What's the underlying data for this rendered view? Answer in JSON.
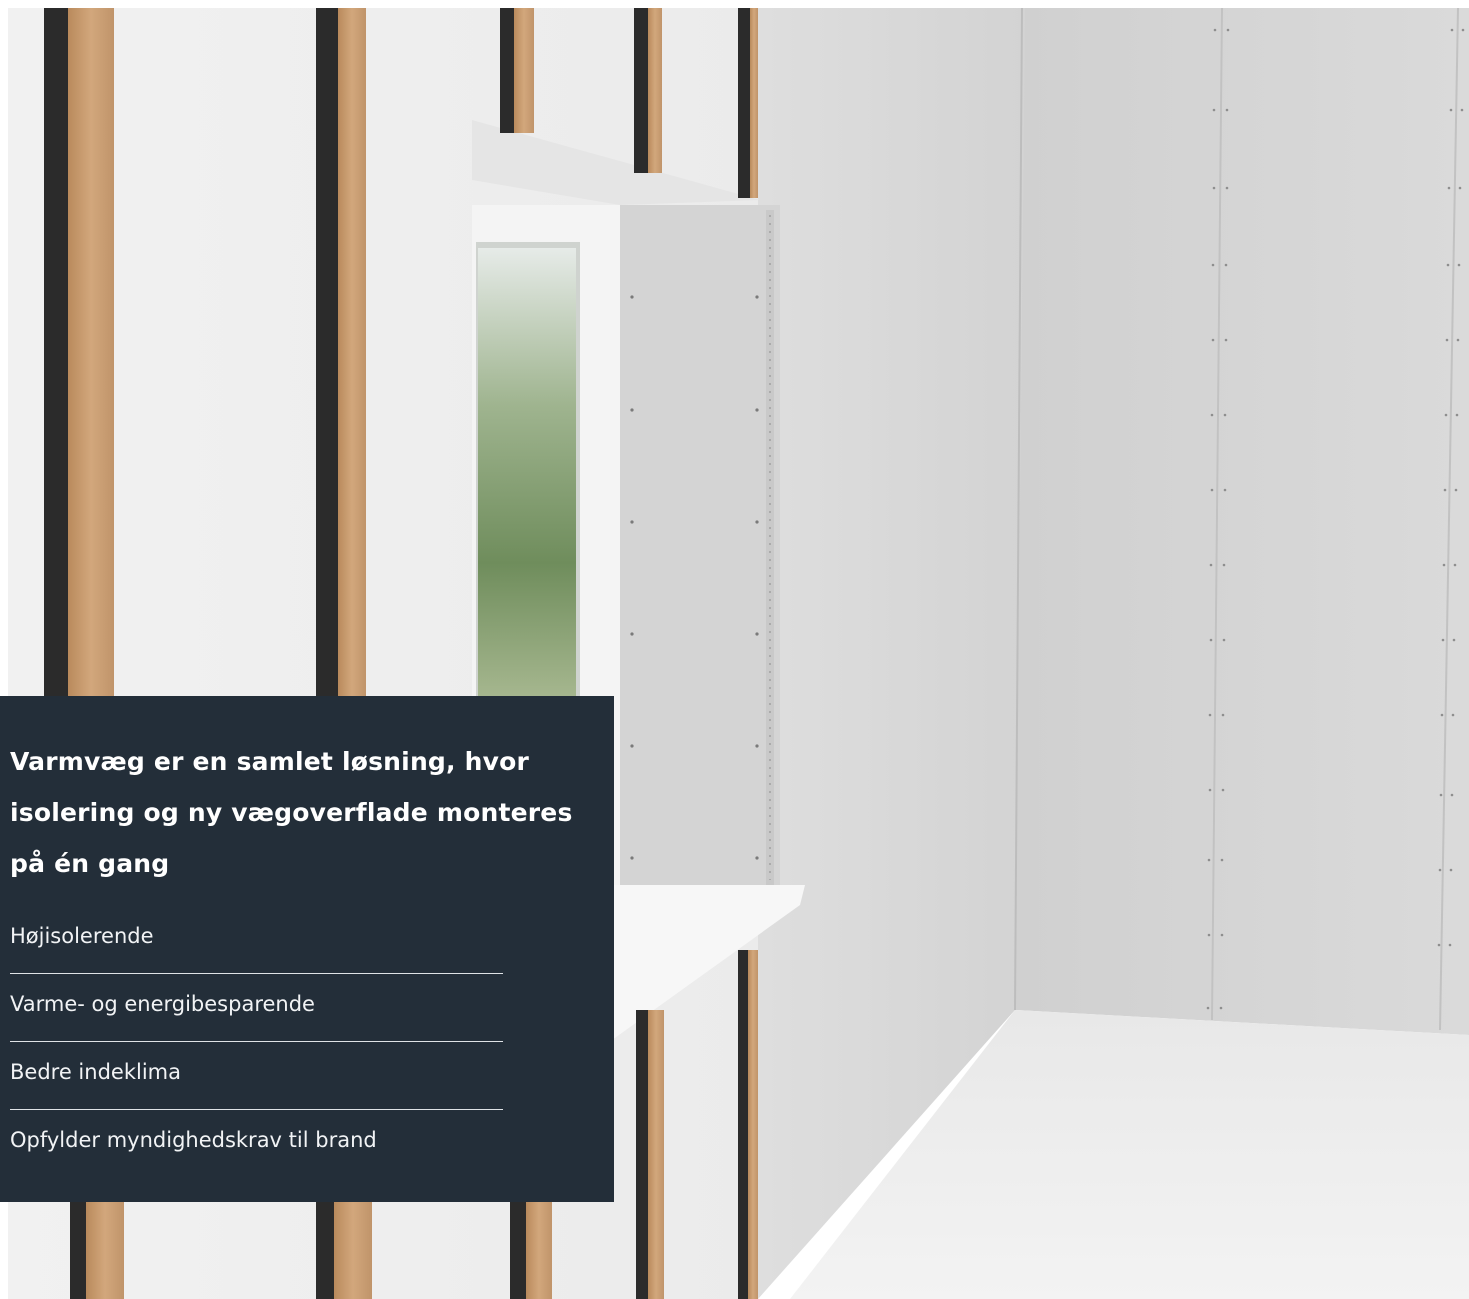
{
  "hero_image": {
    "subject": "interior-wall-insulation-scene"
  },
  "info_panel": {
    "heading": "Varmvæg er en samlet løsning, hvor isolering og ny vægoverflade monteres på én gang",
    "features": [
      {
        "label": "Højisolerende"
      },
      {
        "label": "Varme- og energibesparende"
      },
      {
        "label": "Bedre indeklima"
      },
      {
        "label": "Opfylder myndighedskrav til brand"
      }
    ]
  },
  "colors": {
    "panel_background": "#232e39",
    "panel_text": "#ffffff",
    "divider": "#dfe3e7",
    "wood_batten": "#c69a6e",
    "black_strip": "#2a2a2a",
    "wall_light": "#e7e7e7",
    "board_grey": "#d6d6d6"
  }
}
